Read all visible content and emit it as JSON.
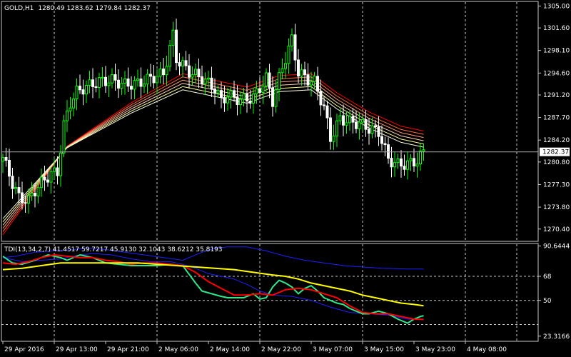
{
  "header": {
    "title": "GOLD,H1",
    "ohlc": "1280.49 1283.62 1279.84 1282.37"
  },
  "indicator": {
    "label": "TDI(13,34,2,7) 41.4517 59.7217 45.9130 32.1043 38.6212 35.8193"
  },
  "colors": {
    "background": "#000000",
    "grid": "#c8c8c8",
    "bull_candle": "#00ff00",
    "bear_candle": "#ffffff",
    "bands": [
      "#ff0000",
      "#ff6a3c",
      "#ff9a78",
      "#ffd2b4",
      "#ffff96",
      "#ffffe6"
    ],
    "bollinger": "#1f1fff",
    "rsi_price": "#2ee88a",
    "signal": "#ff0000",
    "market_base": "#ffff00"
  },
  "chart_data": [
    {
      "type": "candlestick",
      "symbol": "GOLD",
      "timeframe": "H1",
      "ylim": [
        1268.6,
        1305.6
      ],
      "yticks": [
        1305.0,
        1301.6,
        1298.1,
        1294.6,
        1291.2,
        1287.7,
        1284.2,
        1280.8,
        1277.3,
        1273.8,
        1270.4
      ],
      "ytick_labels": [
        "1305.00",
        "1301.60",
        "1298.10",
        "1294.60",
        "1291.20",
        "1287.70",
        "1284.20",
        "1280.80",
        "1277.30",
        "1273.80",
        "1270.40"
      ],
      "current_price": 1282.37,
      "current_price_label": "1282.37",
      "close_trace": [
        [
          0,
          1281.5
        ],
        [
          3,
          1277.5
        ],
        [
          5,
          1275.3
        ],
        [
          8,
          1274.8
        ],
        [
          10,
          1276.4
        ],
        [
          13,
          1278.1
        ],
        [
          15,
          1279.0
        ],
        [
          17,
          1279.2
        ],
        [
          19,
          1286.5
        ],
        [
          21,
          1290.0
        ],
        [
          23,
          1291.7
        ],
        [
          26,
          1292.5
        ],
        [
          30,
          1293.3
        ],
        [
          34,
          1293.5
        ],
        [
          38,
          1292.8
        ],
        [
          42,
          1293.0
        ],
        [
          46,
          1293.8
        ],
        [
          50,
          1294.5
        ],
        [
          53,
          1300.5
        ],
        [
          54,
          1296.8
        ],
        [
          58,
          1294.8
        ],
        [
          62,
          1293.8
        ],
        [
          66,
          1292.2
        ],
        [
          68,
          1290.3
        ],
        [
          70,
          1291.2
        ],
        [
          74,
          1290.4
        ],
        [
          78,
          1290.8
        ],
        [
          82,
          1293.8
        ],
        [
          84,
          1290.3
        ],
        [
          87,
          1295.5
        ],
        [
          90,
          1299.8
        ],
        [
          92,
          1294.7
        ],
        [
          95,
          1293.6
        ],
        [
          97,
          1293.2
        ],
        [
          100,
          1289.2
        ],
        [
          102,
          1284.5
        ],
        [
          105,
          1287.5
        ],
        [
          108,
          1287.0
        ],
        [
          111,
          1286.8
        ],
        [
          114,
          1286.0
        ],
        [
          117,
          1285.5
        ],
        [
          120,
          1281.2
        ],
        [
          123,
          1280.4
        ],
        [
          126,
          1280.5
        ],
        [
          129,
          1281.0
        ],
        [
          131,
          1282.4
        ]
      ],
      "band_lines_start": [
        1269.5,
        1270.0,
        1270.5,
        1271.0,
        1271.5,
        1272.0
      ],
      "band_lines_peak": [
        1294.5,
        1294.0,
        1293.5,
        1293.0,
        1292.5,
        1292.0
      ],
      "band_lines_end": [
        1285.6,
        1285.1,
        1284.6,
        1284.1,
        1283.6,
        1283.1
      ]
    },
    {
      "type": "line",
      "title": "TDI(13,34,2,7)",
      "ylim": [
        20,
        92
      ],
      "yticks": [
        90.6444,
        68,
        50,
        23.3166
      ],
      "ytick_labels": [
        "90.6444",
        "68",
        "50",
        "23.3166"
      ],
      "levels": [
        68,
        50,
        32
      ],
      "series": [
        {
          "values": [
            [
              0,
              82
            ],
            [
              6,
              79
            ],
            [
              12,
              80
            ],
            [
              18,
              81
            ],
            [
              24,
              84
            ],
            [
              28,
              85
            ],
            [
              34,
              84
            ],
            [
              40,
              81
            ],
            [
              46,
              79
            ],
            [
              52,
              79
            ],
            [
              56,
              77
            ],
            [
              60,
              74
            ],
            [
              64,
              70
            ],
            [
              68,
              68
            ],
            [
              72,
              66
            ],
            [
              76,
              62
            ],
            [
              80,
              57
            ],
            [
              84,
              54
            ],
            [
              90,
              53
            ],
            [
              96,
              50
            ],
            [
              102,
              45
            ],
            [
              108,
              41
            ],
            [
              114,
              40
            ],
            [
              120,
              39
            ],
            [
              126,
              36
            ],
            [
              131,
              35.5
            ]
          ]
        },
        {
          "values": [
            [
              0,
              82
            ],
            [
              4,
              83
            ],
            [
              10,
              86
            ],
            [
              16,
              87
            ],
            [
              22,
              88
            ],
            [
              26,
              89
            ],
            [
              32,
              88
            ],
            [
              38,
              86
            ],
            [
              44,
              84
            ],
            [
              50,
              82
            ],
            [
              56,
              80
            ],
            [
              62,
              86
            ],
            [
              66,
              89
            ],
            [
              70,
              90
            ],
            [
              76,
              90
            ],
            [
              82,
              87
            ],
            [
              88,
              83
            ],
            [
              94,
              80
            ],
            [
              100,
              78
            ],
            [
              106,
              76
            ],
            [
              112,
              75
            ],
            [
              118,
              74
            ],
            [
              126,
              73.5
            ],
            [
              131,
              73.5
            ]
          ]
        },
        {
          "values": [
            [
              0,
              63
            ],
            [
              6,
              61
            ],
            [
              12,
              58
            ],
            [
              18,
              57
            ],
            [
              24,
              60
            ],
            [
              28,
              62
            ],
            [
              34,
              65
            ],
            [
              40,
              66
            ],
            [
              46,
              66
            ],
            [
              52,
              64
            ],
            [
              56,
              62
            ],
            [
              62,
              55
            ],
            [
              66,
              50
            ],
            [
              70,
              48
            ],
            [
              76,
              46
            ],
            [
              82,
              44
            ],
            [
              88,
              42
            ],
            [
              94,
              40
            ],
            [
              100,
              39
            ],
            [
              106,
              38
            ],
            [
              112,
              36
            ],
            [
              118,
              36
            ],
            [
              124,
              33
            ],
            [
              131,
              33
            ]
          ]
        },
        {
          "values": [
            [
              0,
              83
            ],
            [
              3,
              78
            ],
            [
              6,
              77
            ],
            [
              10,
              80
            ],
            [
              14,
              84
            ],
            [
              18,
              82
            ],
            [
              20,
              80
            ],
            [
              24,
              84
            ],
            [
              28,
              82
            ],
            [
              32,
              78
            ],
            [
              36,
              77
            ],
            [
              40,
              76
            ],
            [
              44,
              76
            ],
            [
              48,
              76
            ],
            [
              52,
              77
            ],
            [
              56,
              76
            ],
            [
              60,
              63
            ],
            [
              62,
              57
            ],
            [
              65,
              55
            ],
            [
              68,
              53
            ],
            [
              70,
              52
            ],
            [
              73,
              52
            ],
            [
              75,
              52
            ],
            [
              78,
              55
            ],
            [
              80,
              51
            ],
            [
              82,
              52
            ],
            [
              84,
              60
            ],
            [
              86,
              65
            ],
            [
              88,
              63
            ],
            [
              90,
              60
            ],
            [
              92,
              55
            ],
            [
              94,
              59
            ],
            [
              96,
              61
            ],
            [
              98,
              57
            ],
            [
              100,
              52
            ],
            [
              102,
              50
            ],
            [
              104,
              48
            ],
            [
              106,
              47
            ],
            [
              108,
              44
            ],
            [
              110,
              42
            ],
            [
              112,
              40
            ],
            [
              114,
              40
            ],
            [
              117,
              42
            ],
            [
              120,
              40
            ],
            [
              123,
              36
            ],
            [
              126,
              33
            ],
            [
              128,
              36
            ],
            [
              130,
              38
            ],
            [
              131,
              38.6
            ]
          ]
        },
        {
          "values": [
            [
              0,
              78
            ],
            [
              4,
              77
            ],
            [
              8,
              79
            ],
            [
              12,
              82
            ],
            [
              16,
              84
            ],
            [
              20,
              83
            ],
            [
              24,
              82
            ],
            [
              28,
              82
            ],
            [
              32,
              80
            ],
            [
              36,
              79
            ],
            [
              40,
              77
            ],
            [
              44,
              78
            ],
            [
              48,
              78
            ],
            [
              52,
              77
            ],
            [
              56,
              76
            ],
            [
              60,
              71
            ],
            [
              64,
              64
            ],
            [
              68,
              59
            ],
            [
              72,
              54
            ],
            [
              76,
              54
            ],
            [
              80,
              55
            ],
            [
              84,
              54
            ],
            [
              88,
              58
            ],
            [
              92,
              59
            ],
            [
              96,
              58
            ],
            [
              100,
              55
            ],
            [
              104,
              52
            ],
            [
              108,
              46
            ],
            [
              112,
              41
            ],
            [
              116,
              40
            ],
            [
              120,
              40
            ],
            [
              124,
              38
            ],
            [
              128,
              36
            ],
            [
              131,
              35.8
            ]
          ]
        },
        {
          "values": [
            [
              0,
              73
            ],
            [
              6,
              74
            ],
            [
              12,
              76
            ],
            [
              18,
              78
            ],
            [
              24,
              78
            ],
            [
              30,
              78
            ],
            [
              36,
              78
            ],
            [
              42,
              78
            ],
            [
              48,
              77
            ],
            [
              54,
              76
            ],
            [
              60,
              75
            ],
            [
              66,
              74
            ],
            [
              72,
              73
            ],
            [
              78,
              71
            ],
            [
              84,
              69
            ],
            [
              88,
              68
            ],
            [
              92,
              66
            ],
            [
              96,
              63
            ],
            [
              100,
              61
            ],
            [
              104,
              59
            ],
            [
              108,
              57
            ],
            [
              112,
              54
            ],
            [
              116,
              52
            ],
            [
              120,
              50
            ],
            [
              124,
              48
            ],
            [
              128,
              47
            ],
            [
              131,
              46
            ]
          ]
        }
      ]
    }
  ],
  "x_axis": {
    "labels": [
      "29 Apr 2016",
      "29 Apr 13:00",
      "29 Apr 21:00",
      "2 May 06:00",
      "2 May 14:00",
      "2 May 22:00",
      "3 May 07:00",
      "3 May 15:00",
      "3 May 23:00",
      "4 May 08:00"
    ],
    "label_positions": [
      0,
      16,
      32,
      48,
      64,
      80,
      96,
      112,
      128,
      144
    ]
  },
  "vertical_grid_at": [
    0,
    16,
    48,
    80,
    112,
    144,
    160
  ]
}
